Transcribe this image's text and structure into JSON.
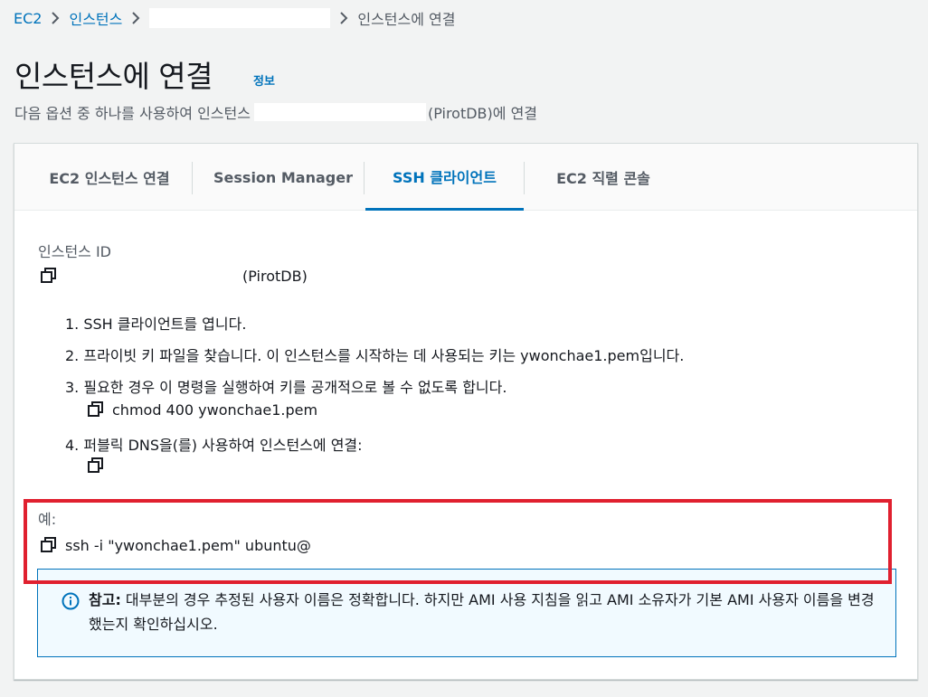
{
  "breadcrumb": {
    "ec2": "EC2",
    "instances": "인스턴스",
    "current": "인스턴스에 연결"
  },
  "page": {
    "title": "인스턴스에 연결",
    "info": "정보",
    "subtitle_prefix": "다음 옵션 중 하나를 사용하여 인스턴스",
    "subtitle_suffix": "(PirotDB)에 연결"
  },
  "tabs": [
    {
      "label": "EC2 인스턴스 연결"
    },
    {
      "label": "Session Manager"
    },
    {
      "label": "SSH 클라이언트"
    },
    {
      "label": "EC2 직렬 콘솔"
    }
  ],
  "instance": {
    "label": "인스턴스 ID",
    "name_suffix": "(PirotDB)"
  },
  "steps": [
    "1. SSH 클라이언트를 엽니다.",
    "2. 프라이빗 키 파일을 찾습니다. 이 인스턴스를 시작하는 데 사용되는 키는 ywonchae1.pem입니다.",
    "3. 필요한 경우 이 명령을 실행하여 키를 공개적으로 볼 수 없도록 합니다.",
    "4. 퍼블릭 DNS을(를) 사용하여 인스턴스에 연결:"
  ],
  "chmod_command": "chmod 400 ywonchae1.pem",
  "example": {
    "label": "예:",
    "command": "ssh -i \"ywonchae1.pem\" ubuntu@"
  },
  "note": {
    "bold": "참고:",
    "text": " 대부분의 경우 추정된 사용자 이름은 정확합니다. 하지만 AMI 사용 지침을 읽고 AMI 소유자가 기본 AMI 사용자 이름을 변경했는지 확인하십시오."
  },
  "colors": {
    "link": "#0073bb",
    "highlight_border": "#e0202f",
    "note_bg": "#f1faff"
  }
}
